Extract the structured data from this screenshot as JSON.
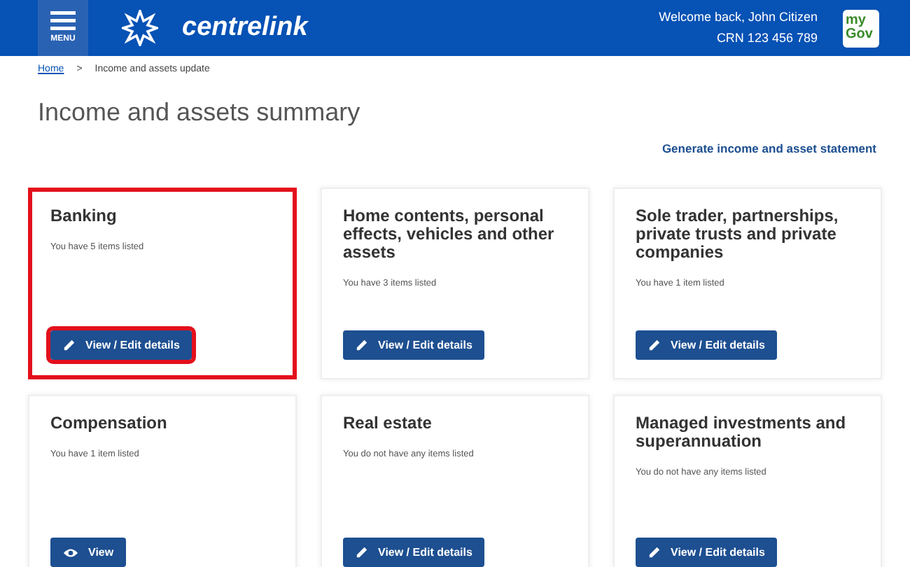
{
  "header": {
    "menu_label": "MENU",
    "brand": "centrelink",
    "welcome": "Welcome back, John Citizen",
    "crn": "CRN 123 456 789",
    "mygov_top": "my",
    "mygov_bottom": "Gov"
  },
  "breadcrumb": {
    "home": "Home",
    "separator": ">",
    "current": "Income and assets update"
  },
  "title": "Income and assets summary",
  "statement_link": "Generate income and asset statement",
  "cards": [
    {
      "title": "Banking",
      "summary": "You have 5 items listed",
      "button": {
        "kind": "edit",
        "label": "View / Edit details"
      },
      "highlighted": true
    },
    {
      "title": "Home contents, personal effects, vehicles and other assets",
      "summary": "You have 3 items listed",
      "button": {
        "kind": "edit",
        "label": "View / Edit details"
      },
      "highlighted": false
    },
    {
      "title": "Sole trader, partnerships, private trusts and private companies",
      "summary": "You have 1 item listed",
      "button": {
        "kind": "edit",
        "label": "View / Edit details"
      },
      "highlighted": false
    },
    {
      "title": "Compensation",
      "summary": "You have 1 item listed",
      "button": {
        "kind": "view",
        "label": "View"
      },
      "highlighted": false
    },
    {
      "title": "Real estate",
      "summary": "You do not have any items listed",
      "button": {
        "kind": "edit",
        "label": "View / Edit details"
      },
      "highlighted": false
    },
    {
      "title": "Managed investments and superannuation",
      "summary": "You do not have any items listed",
      "button": {
        "kind": "edit",
        "label": "View / Edit details"
      },
      "highlighted": false
    }
  ]
}
